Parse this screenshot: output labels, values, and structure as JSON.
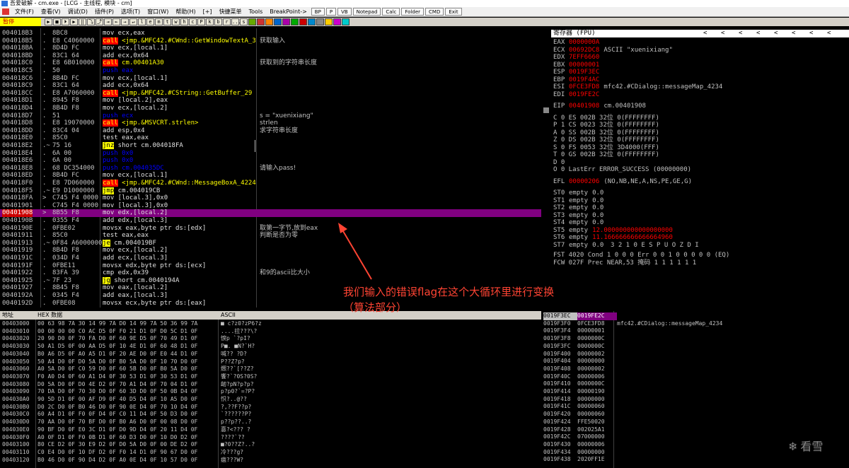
{
  "window": {
    "title": "吾爱破解 - cm.exe - [LCG - 主线程, 模块 - cm]"
  },
  "menu": {
    "items": [
      "文件(F)",
      "查看(V)",
      "调试(D)",
      "插件(P)",
      "选项(T)",
      "窗口(W)",
      "帮助(H)",
      "[+]",
      "快捷菜单",
      "Tools",
      "BreakPoint->"
    ],
    "buttons": [
      "BP",
      "P",
      "VB",
      "Notepad",
      "Calc",
      "Folder",
      "CMD",
      "Exit"
    ]
  },
  "toolbar": {
    "status": "暂停",
    "letters": [
      "l",
      "e",
      "m",
      "t",
      "w",
      "h",
      "c",
      "P",
      "k",
      "b",
      "r",
      "...",
      "s"
    ]
  },
  "cpu": {
    "rows": [
      {
        "addr": "004018B3",
        "mark": ".",
        "hex": "8BC8",
        "dis": "mov ecx,eax",
        "kind": "n",
        "cmt": ""
      },
      {
        "addr": "004018B5",
        "mark": ".",
        "hex": "E8 C4060000",
        "dis": "call <jmp.&MFC42.#CWnd::GetWindowTextA_3",
        "kind": "call",
        "cmt": "获取输入"
      },
      {
        "addr": "004018BA",
        "mark": ".",
        "hex": "8D4D FC",
        "dis": "mov ecx,[local.1]",
        "kind": "n",
        "cmt": ""
      },
      {
        "addr": "004018BD",
        "mark": ".",
        "hex": "83C1 64",
        "dis": "add ecx,0x64",
        "kind": "add",
        "cmt": ""
      },
      {
        "addr": "004018C0",
        "mark": ".",
        "hex": "E8 6B010000",
        "dis": "call cm.00401A30",
        "kind": "call",
        "cmt": "获取到的字符串长度"
      },
      {
        "addr": "004018C5",
        "mark": ".",
        "hex": "50",
        "dis": "push eax",
        "kind": "push",
        "cmt": ""
      },
      {
        "addr": "004018C6",
        "mark": ".",
        "hex": "8B4D FC",
        "dis": "mov ecx,[local.1]",
        "kind": "n",
        "cmt": ""
      },
      {
        "addr": "004018C9",
        "mark": ".",
        "hex": "83C1 64",
        "dis": "add ecx,0x64",
        "kind": "add",
        "cmt": ""
      },
      {
        "addr": "004018CC",
        "mark": ".",
        "hex": "E8 A7060000",
        "dis": "call <jmp.&MFC42.#CString::GetBuffer_29",
        "kind": "call",
        "cmt": ""
      },
      {
        "addr": "004018D1",
        "mark": ".",
        "hex": "8945 F8",
        "dis": "mov [local.2],eax",
        "kind": "n",
        "cmt": ""
      },
      {
        "addr": "004018D4",
        "mark": ".",
        "hex": "8B4D F8",
        "dis": "mov ecx,[local.2]",
        "kind": "n",
        "cmt": ""
      },
      {
        "addr": "004018D7",
        "mark": ".",
        "hex": "51",
        "dis": "push ecx",
        "kind": "push",
        "cmt": "s = \"xuenixiang\""
      },
      {
        "addr": "004018D8",
        "mark": ".",
        "hex": "E8 19070000",
        "dis": "call <jmp.&MSVCRT.strlen>",
        "kind": "call",
        "cmt": "strlen"
      },
      {
        "addr": "004018DD",
        "mark": ".",
        "hex": "83C4 04",
        "dis": "add esp,0x4",
        "kind": "add",
        "cmt": "求字符串长度"
      },
      {
        "addr": "004018E0",
        "mark": ".",
        "hex": "85C0",
        "dis": "test eax,eax",
        "kind": "n",
        "cmt": ""
      },
      {
        "addr": "004018E2",
        "mark": ".~",
        "hex": "75 16",
        "dis": "jnz short cm.004018FA",
        "kind": "jmp",
        "cmt": ""
      },
      {
        "addr": "004018E4",
        "mark": ".",
        "hex": "6A 00",
        "dis": "push 0x0",
        "kind": "push",
        "cmt": ""
      },
      {
        "addr": "004018E6",
        "mark": ".",
        "hex": "6A 00",
        "dis": "push 0x0",
        "kind": "push",
        "cmt": ""
      },
      {
        "addr": "004018E8",
        "mark": ".",
        "hex": "68 DC354000",
        "dis": "push cm.004035DC",
        "kind": "push",
        "cmt": "请输入pass!"
      },
      {
        "addr": "004018ED",
        "mark": ".",
        "hex": "8B4D FC",
        "dis": "mov ecx,[local.1]",
        "kind": "n",
        "cmt": ""
      },
      {
        "addr": "004018F0",
        "mark": ".",
        "hex": "E8 7D060000",
        "dis": "call <jmp.&MFC42.#CWnd::MessageBoxA_4224",
        "kind": "call",
        "cmt": ""
      },
      {
        "addr": "004018F5",
        "mark": ".~",
        "hex": "E9 D1000000",
        "dis": "jmp cm.004019CB",
        "kind": "jmp",
        "cmt": ""
      },
      {
        "addr": "004018FA",
        "mark": ">",
        "hex": "C745 F4 0000",
        "dis": "mov [local.3],0x0",
        "kind": "add",
        "cmt": ""
      },
      {
        "addr": "00401901",
        "mark": ".",
        "hex": "C745 F4 0000",
        "dis": "mov [local.3],0x0",
        "kind": "add",
        "cmt": ""
      },
      {
        "addr": "00401908",
        "mark": ">",
        "hex": "8B55 F8",
        "dis": "mov edx,[local.2]",
        "kind": "n",
        "cmt": "",
        "sel": true
      },
      {
        "addr": "0040190B",
        "mark": ".",
        "hex": "0355 F4",
        "dis": " add edx,[local.3]",
        "kind": "n",
        "cmt": ""
      },
      {
        "addr": "0040190E",
        "mark": ".",
        "hex": "0FBE02",
        "dis": " movsx eax,byte ptr ds:[edx]",
        "kind": "n",
        "cmt": "取第一字节,放到eax"
      },
      {
        "addr": "00401911",
        "mark": ".",
        "hex": "85C0",
        "dis": " test eax,eax",
        "kind": "n",
        "cmt": "判断是否为零"
      },
      {
        "addr": "00401913",
        "mark": ".~",
        "hex": "0F84 A6000000",
        "dis": " je cm.004019BF",
        "kind": "jmp",
        "cmt": ""
      },
      {
        "addr": "00401919",
        "mark": ".",
        "hex": "8B4D F8",
        "dis": " mov ecx,[local.2]",
        "kind": "n",
        "cmt": ""
      },
      {
        "addr": "0040191C",
        "mark": ".",
        "hex": "034D F4",
        "dis": " add ecx,[local.3]",
        "kind": "n",
        "cmt": ""
      },
      {
        "addr": "0040191F",
        "mark": ".",
        "hex": "0FBE11",
        "dis": " movsx edx,byte ptr ds:[ecx]",
        "kind": "n",
        "cmt": ""
      },
      {
        "addr": "00401922",
        "mark": ".",
        "hex": "83FA 39",
        "dis": " cmp edx,0x39",
        "kind": "n",
        "cmt": "和9的ascii比大小"
      },
      {
        "addr": "00401925",
        "mark": ".~",
        "hex": "7F 23",
        "dis": " jg short cm.0040194A",
        "kind": "jmp",
        "cmt": ""
      },
      {
        "addr": "00401927",
        "mark": ".",
        "hex": "8B45 F8",
        "dis": " mov eax,[local.2]",
        "kind": "n",
        "cmt": ""
      },
      {
        "addr": "0040192A",
        "mark": ".",
        "hex": "0345 F4",
        "dis": " add eax,[local.3]",
        "kind": "n",
        "cmt": ""
      },
      {
        "addr": "0040192D",
        "mark": ".",
        "hex": "0FBE08",
        "dis": " movsx ecx,byte ptr ds:[eax]",
        "kind": "n",
        "cmt": ""
      }
    ]
  },
  "registers": {
    "header": "寄存器 (FPU)",
    "general": [
      {
        "n": "EAX",
        "v": "0000000A",
        "c": ""
      },
      {
        "n": "ECX",
        "v": "00692DC8",
        "c": "ASCII \"xuenixiang\""
      },
      {
        "n": "EDX",
        "v": "7EFF6660",
        "c": ""
      },
      {
        "n": "EBX",
        "v": "00000001",
        "c": ""
      },
      {
        "n": "ESP",
        "v": "0019F3EC",
        "c": ""
      },
      {
        "n": "EBP",
        "v": "0019F4AC",
        "c": ""
      },
      {
        "n": "ESI",
        "v": "0FCE3FD8",
        "c": "mfc42.#CDialog::messageMap_4234"
      },
      {
        "n": "EDI",
        "v": "0019FE2C",
        "c": ""
      }
    ],
    "eip": {
      "n": "EIP",
      "v": "00401908",
      "c": "cm.00401908"
    },
    "flags": [
      "C 0  ES 002B 32位 0(FFFFFFFF)",
      "P 1  CS 0023 32位 0(FFFFFFFF)",
      "A 0  SS 002B 32位 0(FFFFFFFF)",
      "Z 0  DS 002B 32位 0(FFFFFFFF)",
      "S 0  FS 0053 32位 3D4000(FFF)",
      "T 0  GS 002B 32位 0(FFFFFFFF)",
      "D 0",
      "O 0  LastErr ERROR_SUCCESS (00000000)"
    ],
    "efl": {
      "n": "EFL",
      "v": "00000206",
      "c": "(NO,NB,NE,A,NS,PE,GE,G)"
    },
    "fpu": [
      {
        "n": "ST0",
        "s": "empty",
        "v": "0.0",
        "red": false
      },
      {
        "n": "ST1",
        "s": "empty",
        "v": "0.0",
        "red": false
      },
      {
        "n": "ST2",
        "s": "empty",
        "v": "0.0",
        "red": false
      },
      {
        "n": "ST3",
        "s": "empty",
        "v": "0.0",
        "red": false
      },
      {
        "n": "ST4",
        "s": "empty",
        "v": "0.0",
        "red": false
      },
      {
        "n": "ST5",
        "s": "empty",
        "v": "12.000000000000000000",
        "red": true
      },
      {
        "n": "ST6",
        "s": "empty",
        "v": "11.166666666666664960",
        "red": true
      },
      {
        "n": "ST7",
        "s": "empty",
        "v": "0.0",
        "red": false
      }
    ],
    "fpu_bits_label": "3 2 1 0      E S P U O Z D I",
    "fst": "FST 4020  Cond 1 0 0 0  Err 0 0 1 0 0 0 0 0  (EQ)",
    "fcw": "FCW 027F  Prec NEAR,53  掩码    1 1 1 1 1 1"
  },
  "dump": {
    "header_addr": "地址",
    "header_hex": "HEX 数据",
    "header_ascii": "ASCII",
    "rows": [
      {
        "a": "00403000",
        "h": "00 63 98 7A 30 14 99 7A D0 14 99 7A 50 36 99 7A",
        "s": "■ c?z0?zP6?z"
      },
      {
        "a": "00403010",
        "h": "00 00 00 00 C0 AC D5 0F F0 21 D1 0F D0 5C D1 0F",
        "s": "....拉???\\?"
      },
      {
        "a": "00403020",
        "h": "20 90 D0 0F 70 FA D0 0F 60 9E D5 0F 70 49 D1 0F",
        "s": " 悷p  `?pI?"
      },
      {
        "a": "00403030",
        "h": "50 A1 D5 0F 00 AA D5 0F 10 4E D1 0F 60 48 D1 0F",
        "s": "P■.  ■N?`H?"
      },
      {
        "a": "00403040",
        "h": "B0 A6 D5 0F A0 A5 D1 0F 20 AE D0 0F E0 44 D1 0F",
        "s": "喊??  ?D?"
      },
      {
        "a": "00403050",
        "h": "50 A4 D0 0F D0 5A D0 0F B0 5A D0 0F 10 70 D0 0F",
        "s": "P??Z?p?"
      },
      {
        "a": "00403060",
        "h": "A0 5A D0 0F C0 59 D0 0F 60 5B D0 0F B0 5A D0 0F",
        "s": "燳??`[??Z?"
      },
      {
        "a": "00403070",
        "h": "F0 A0 D4 0F 60 A1 D4 0F 30 53 D1 0F 30 53 D1 0F",
        "s": "饗?`?0S?0S?"
      },
      {
        "a": "00403080",
        "h": "D0 5A D0 0F D0 4E D2 0F 70 A1 D4 0F 70 04 D1 0F",
        "s": "衂?pN?p?p?"
      },
      {
        "a": "00403090",
        "h": "70 DA D0 0F 70 30 D0 0F 60 3D D0 0F 50 0B D4 0F",
        "s": "p?p0?`=?P?"
      },
      {
        "a": "004030A0",
        "h": "90 5D D1 0F 00 AF D9 0F 40 D5 D4 0F 10 A5 D0 0F",
        "s": "怾?..@??"
      },
      {
        "a": "004030B0",
        "h": "D0 2C D0 0F B0 46 D0 0F 90 0E D4 0F 70 10 D4 0F",
        "s": "?,??F??p?"
      },
      {
        "a": "004030C0",
        "h": "60 A4 D1 0F F0 0F D4 0F C0 11 D4 0F 50 D3 D0 0F",
        "s": "`??????P?"
      },
      {
        "a": "004030D0",
        "h": "70 AA D0 0F 70 BF D0 0F B0 A6 D0 0F 00 08 D0 0F",
        "s": "p??p??..?"
      },
      {
        "a": "004030E0",
        "h": "90 BF D0 0F E0 3C D1 0F D0 9D D4 0F 20 11 D4 0F",
        "s": "惪?<??? ?"
      },
      {
        "a": "004030F0",
        "h": "A0 0F D1 0F F0 0B D1 0F 60 D3 D0 0F 10 D0 D2 0F",
        "s": "????`??"
      },
      {
        "a": "00403100",
        "h": "80 CE D2 0F 30 E9 D2 0F D0 5A D0 0F 00 DE D2 0F",
        "s": "■?0??Z?..?"
      },
      {
        "a": "00403110",
        "h": "C0 E4 D0 0F 10 DF D2 0F F0 14 D1 0F 90 67 D0 0F",
        "s": "冷???g?"
      },
      {
        "a": "00403120",
        "h": "B0 46 D0 0F 90 D4 D2 0F A0 0E D4 0F 10 57 D0 0F",
        "s": "癋???W?"
      }
    ]
  },
  "stack": {
    "rows": [
      {
        "a": "0019F3EC",
        "v": "0019FE2C",
        "c": ""
      },
      {
        "a": "0019F3F0",
        "v": "0FCE3FD8",
        "c": "mfc42.#CDialog::messageMap_4234"
      },
      {
        "a": "0019F3F4",
        "v": "00000001",
        "c": ""
      },
      {
        "a": "0019F3F8",
        "v": "0000000C",
        "c": ""
      },
      {
        "a": "0019F3FC",
        "v": "0000000C",
        "c": ""
      },
      {
        "a": "0019F400",
        "v": "00000002",
        "c": ""
      },
      {
        "a": "0019F404",
        "v": "00000000",
        "c": ""
      },
      {
        "a": "0019F408",
        "v": "00000002",
        "c": ""
      },
      {
        "a": "0019F40C",
        "v": "00000006",
        "c": ""
      },
      {
        "a": "0019F410",
        "v": "0000000C",
        "c": ""
      },
      {
        "a": "0019F414",
        "v": "00000190",
        "c": ""
      },
      {
        "a": "0019F418",
        "v": "00000000",
        "c": ""
      },
      {
        "a": "0019F41C",
        "v": "00000060",
        "c": ""
      },
      {
        "a": "0019F420",
        "v": "00000060",
        "c": ""
      },
      {
        "a": "0019F424",
        "v": "FFE50020",
        "c": ""
      },
      {
        "a": "0019F428",
        "v": "002025A1",
        "c": ""
      },
      {
        "a": "0019F42C",
        "v": "07000000",
        "c": ""
      },
      {
        "a": "0019F430",
        "v": "00000006",
        "c": ""
      },
      {
        "a": "0019F434",
        "v": "00000000",
        "c": ""
      },
      {
        "a": "0019F438",
        "v": "2020FF1E",
        "c": ""
      }
    ]
  },
  "annotation": {
    "line1": "我们输入的错误flag在这个大循环里进行变换",
    "line2": "（算法部分）"
  },
  "watermark": {
    "text": "看雪"
  },
  "colors": {
    "accent_red": "#ff4433",
    "selection": "#800080",
    "register_changed": "#ff0000"
  }
}
